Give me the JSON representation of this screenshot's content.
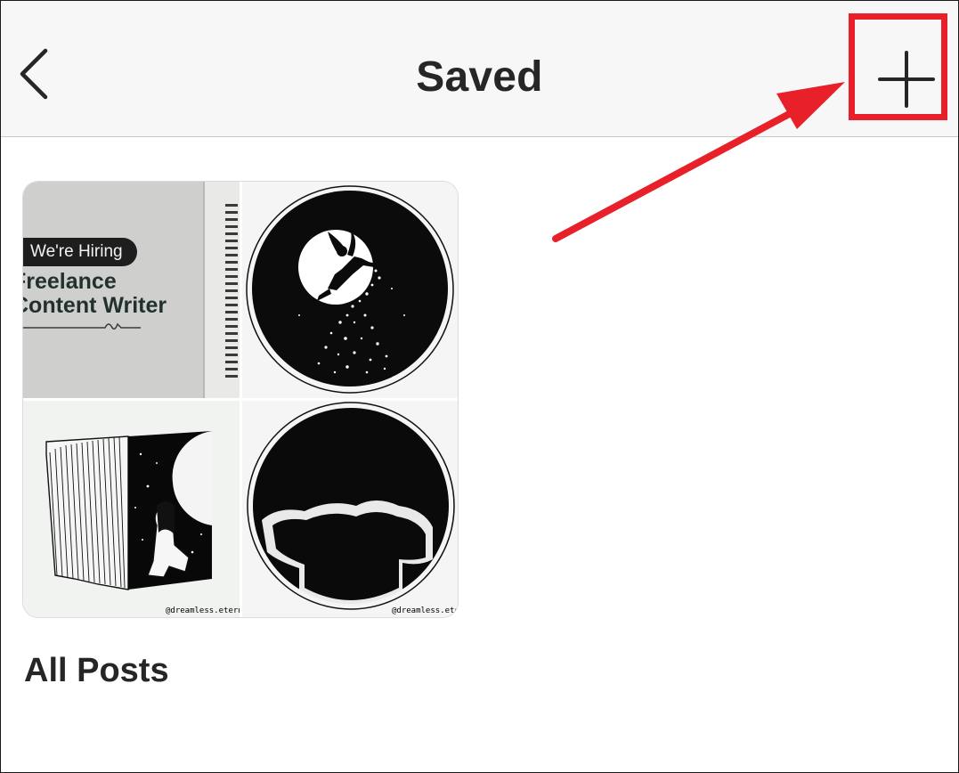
{
  "header": {
    "title": "Saved",
    "back_icon": "chevron-left-icon",
    "add_icon": "plus-icon"
  },
  "annotation": {
    "color": "#e8202a",
    "target": "add-button"
  },
  "collection": {
    "name": "All Posts",
    "tiles": [
      {
        "hiring_badge": "We're Hiring",
        "heading_line1": "Freelance",
        "heading_line2": "Content Writer"
      },
      {
        "art": "fairy-moon-silhouette"
      },
      {
        "art": "book-moon-girl",
        "watermark": "@dreamless.eternity"
      },
      {
        "art": "two-silhouettes-circle",
        "watermark": "@dreamless.eternity"
      }
    ]
  }
}
